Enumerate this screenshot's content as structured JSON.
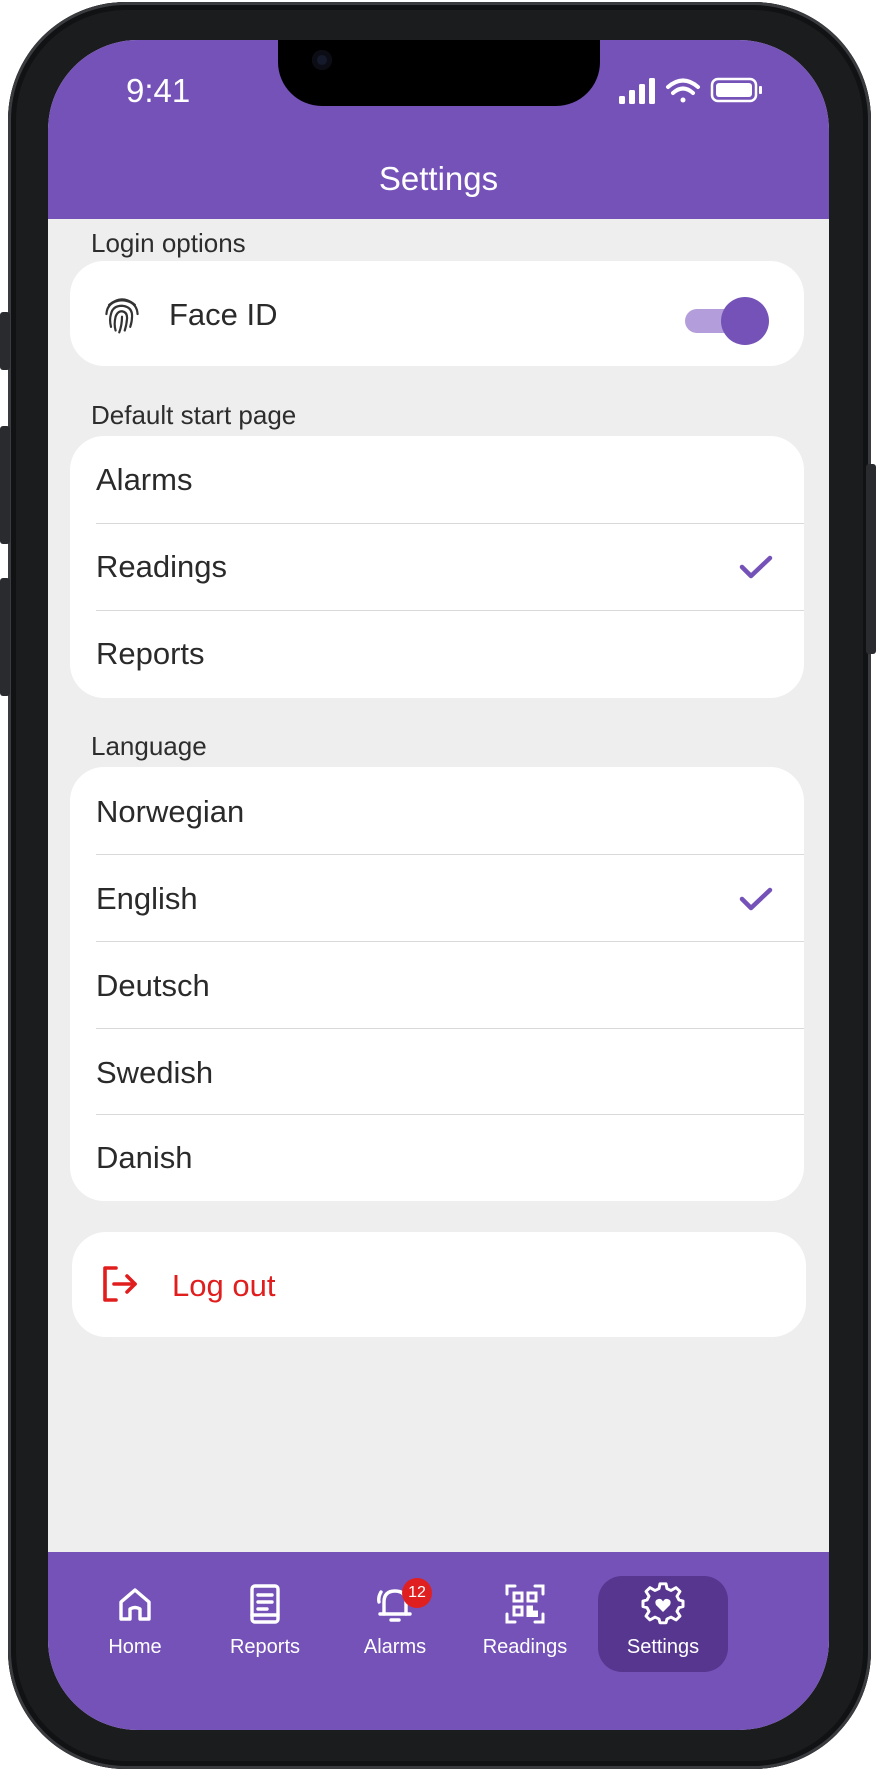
{
  "status_bar": {
    "time": "9:41"
  },
  "header": {
    "title": "Settings"
  },
  "login_options": {
    "label": "Login options",
    "face_id": {
      "label": "Face ID",
      "enabled": true
    }
  },
  "default_start_page": {
    "label": "Default start page",
    "options": [
      {
        "label": "Alarms",
        "selected": false
      },
      {
        "label": "Readings",
        "selected": true
      },
      {
        "label": "Reports",
        "selected": false
      }
    ]
  },
  "language": {
    "label": "Language",
    "options": [
      {
        "label": "Norwegian",
        "selected": false
      },
      {
        "label": "English",
        "selected": true
      },
      {
        "label": "Deutsch",
        "selected": false
      },
      {
        "label": "Swedish",
        "selected": false
      },
      {
        "label": "Danish",
        "selected": false
      }
    ]
  },
  "logout": {
    "label": "Log out"
  },
  "bottom_nav": {
    "items": [
      {
        "label": "Home",
        "icon": "home-icon"
      },
      {
        "label": "Reports",
        "icon": "reports-icon"
      },
      {
        "label": "Alarms",
        "icon": "bell-icon",
        "badge": "12"
      },
      {
        "label": "Readings",
        "icon": "qr-code-icon"
      },
      {
        "label": "Settings",
        "icon": "settings-gear-icon",
        "active": true
      }
    ]
  },
  "colors": {
    "accent": "#7552b8",
    "accent_dark": "#57368f",
    "toggle_track": "#b39ddb",
    "danger": "#e01e1e",
    "background": "#eeeeee"
  }
}
